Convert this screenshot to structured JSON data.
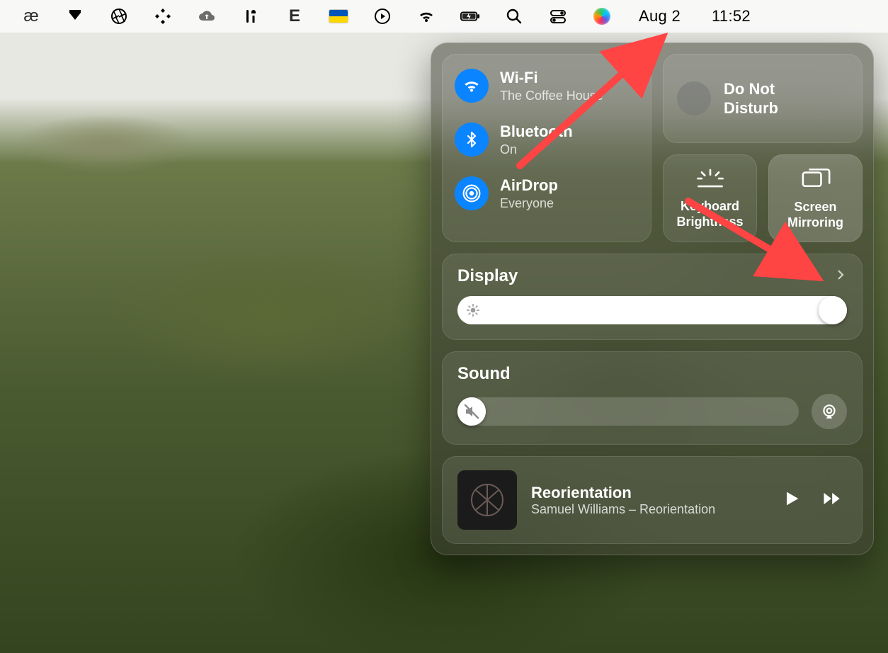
{
  "menubar": {
    "date": "Aug 2",
    "time": "11:52"
  },
  "control_center": {
    "connectivity": {
      "wifi": {
        "label": "Wi-Fi",
        "status": "The Coffee House",
        "on": true
      },
      "bluetooth": {
        "label": "Bluetooth",
        "status": "On",
        "on": true
      },
      "airdrop": {
        "label": "AirDrop",
        "status": "Everyone",
        "on": true
      }
    },
    "dnd": {
      "label_line1": "Do Not",
      "label_line2": "Disturb",
      "on": false
    },
    "keyboard_brightness": {
      "label_line1": "Keyboard",
      "label_line2": "Brightness"
    },
    "screen_mirroring": {
      "label_line1": "Screen",
      "label_line2": "Mirroring"
    },
    "display": {
      "label": "Display",
      "value_pct": 100
    },
    "sound": {
      "label": "Sound",
      "value_pct": 0
    },
    "now_playing": {
      "title": "Reorientation",
      "subtitle": "Samuel Williams – Reorientation"
    }
  },
  "annotation": {
    "arrow1_target": "control-center-menubar-icon",
    "arrow2_target": "display-panel-chevron"
  }
}
